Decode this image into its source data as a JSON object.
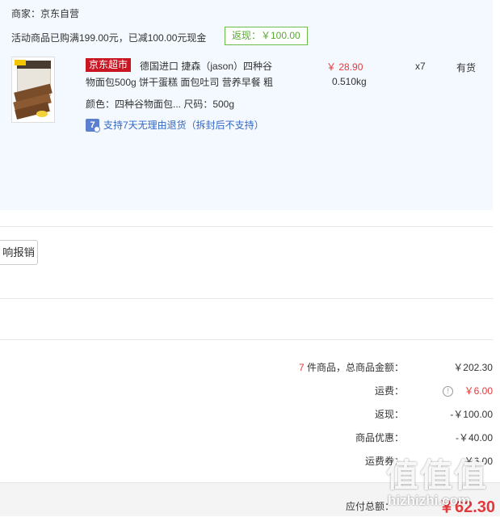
{
  "order": {
    "merchant": "商家：京东自营",
    "promo": "活动商品已购满199.00元，已减100.00元现金",
    "cashback": "返现：￥100.00"
  },
  "item": {
    "jd_tag": "京东超市",
    "title_line1": "德国进口 捷森（jason）四种谷",
    "title_line2": "物面包500g 饼干蛋糕 面包吐司 营养早餐 粗",
    "spec": "颜色：四种谷物面包... 尺码：500g",
    "return_icon": "7",
    "return_policy": "支持7天无理由退货（拆封后不支持）",
    "price": "￥ 28.90",
    "weight": "0.510kg",
    "qty": "x7",
    "stock": "有货"
  },
  "reimburse_button": "响报销",
  "summary": {
    "count_num": "7",
    "count_label": "件商品，总商品金额：",
    "goods_total": "￥202.30",
    "shipping_label": "运费：",
    "shipping_value": "￥6.00",
    "cashback_label": "返现：",
    "cashback_value": "-￥100.00",
    "discount_label": "商品优惠：",
    "discount_value": "-￥40.00",
    "shipping_coupon_label": "运费券：",
    "shipping_coupon_value": "-￥6.00"
  },
  "total": {
    "label": "应付总额：",
    "value": "￥62.30"
  },
  "watermark": {
    "glyphs": "值值值",
    "text": "hizhizhi.com"
  },
  "colors": {
    "accent_red": "#e4393c",
    "jd_red": "#c81623",
    "cashback_green": "#5aa935",
    "panel_bg": "#f3f9fe",
    "link_blue": "#3667c2"
  }
}
